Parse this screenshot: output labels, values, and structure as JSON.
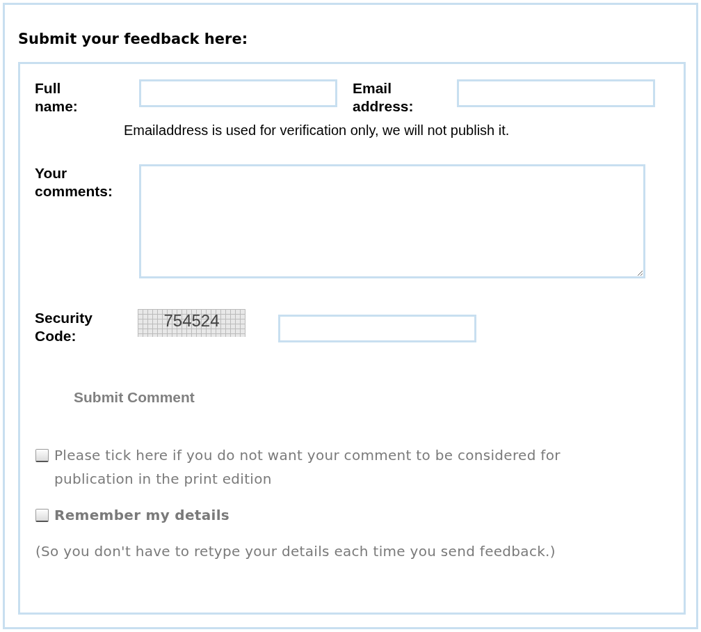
{
  "heading": "Submit your feedback here:",
  "name_field": {
    "label": "Full name:"
  },
  "email_field": {
    "label": "Email address:"
  },
  "email_note": "Emailaddress is used for verification only, we will not publish it.",
  "comments_field": {
    "label": "Your comments:"
  },
  "security": {
    "label": "Security Code:",
    "code": "754524"
  },
  "submit_button": "Submit Comment",
  "options": [
    {
      "kind": "plain",
      "label": "Please tick here if you do not want your comment to be considered for publication in the print edition",
      "checked": false
    },
    {
      "kind": "bold",
      "label": "Remember my details",
      "checked": false
    }
  ],
  "footnote": "(So you don't have to retype your details each time you send feedback.)"
}
